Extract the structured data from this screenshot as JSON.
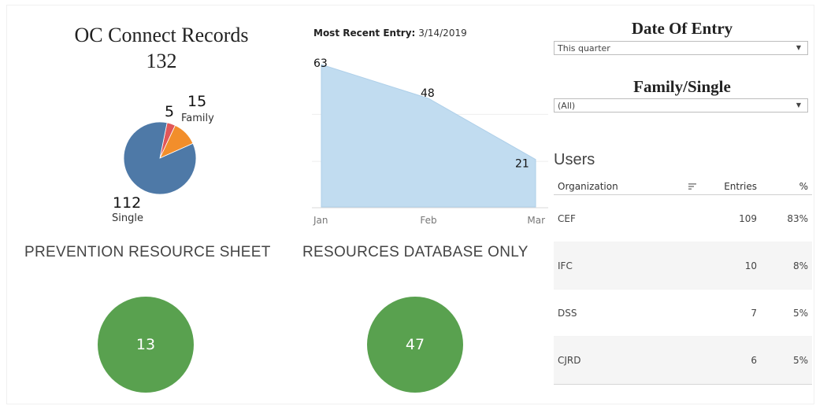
{
  "records": {
    "title": "OC Connect Records",
    "total": "132"
  },
  "pie": {
    "slices": [
      {
        "category": "Single",
        "value": 112,
        "color": "#4e79a7"
      },
      {
        "category": "Family",
        "value": 15,
        "color": "#f28e2b"
      },
      {
        "category": "",
        "value": 5,
        "color": "#e15759"
      }
    ],
    "labels": {
      "single_value": "112",
      "single_name": "Single",
      "family_value": "15",
      "family_name": "Family",
      "other_value": "5"
    }
  },
  "most_recent": {
    "label": "Most Recent Entry:",
    "value": "3/14/2019"
  },
  "chart_data": {
    "type": "area",
    "categories": [
      "Jan",
      "Feb",
      "Mar"
    ],
    "series": [
      {
        "values": [
          63,
          48,
          21
        ],
        "color": "#c1dcf0"
      }
    ],
    "data_labels": [
      "63",
      "48",
      "21"
    ],
    "xlabel": "",
    "ylabel": "",
    "ylim": [
      0,
      63
    ],
    "grid": true
  },
  "prevention": {
    "title": "PREVENTION RESOURCE SHEET",
    "value": "13"
  },
  "resources_db": {
    "title": "RESOURCES DATABASE ONLY",
    "value": "47"
  },
  "filters": {
    "date": {
      "title": "Date Of Entry",
      "selected": "This quarter"
    },
    "family": {
      "title": "Family/Single",
      "selected": "(All)"
    }
  },
  "users": {
    "title": "Users",
    "columns": {
      "org": "Organization",
      "entries": "Entries",
      "pct": "%"
    },
    "rows": [
      {
        "org": "CEF",
        "entries": "109",
        "pct": "83%"
      },
      {
        "org": "IFC",
        "entries": "10",
        "pct": "8%"
      },
      {
        "org": "DSS",
        "entries": "7",
        "pct": "5%"
      },
      {
        "org": "CJRD",
        "entries": "6",
        "pct": "5%"
      }
    ]
  },
  "colors": {
    "kpi_green": "#59a14f",
    "area_fill": "#c1dcf0"
  }
}
